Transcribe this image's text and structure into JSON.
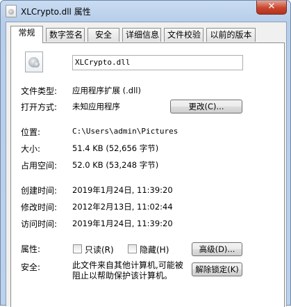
{
  "window": {
    "title": "XLCrypto.dll 属性",
    "close_label": "✕"
  },
  "tabs": [
    {
      "label": "常规",
      "active": true
    },
    {
      "label": "数字签名",
      "active": false
    },
    {
      "label": "安全",
      "active": false
    },
    {
      "label": "详细信息",
      "active": false
    },
    {
      "label": "文件校验",
      "active": false
    },
    {
      "label": "以前的版本",
      "active": false
    }
  ],
  "general": {
    "file_icon": "dll-gear-icon",
    "file_name": "XLCrypto.dll",
    "file_type_label": "文件类型:",
    "file_type_value": "应用程序扩展 (.dll)",
    "opens_with_label": "打开方式:",
    "opens_with_value": "未知应用程序",
    "change_button": "更改(C)...",
    "location_label": "位置:",
    "location_value": "C:\\Users\\admin\\Pictures",
    "size_label": "大小:",
    "size_value": "51.4 KB (52,656 字节)",
    "size_on_disk_label": "占用空间:",
    "size_on_disk_value": "52.0 KB (53,248 字节)",
    "created_label": "创建时间:",
    "created_value": "2019年1月24日, 11:39:20",
    "modified_label": "修改时间:",
    "modified_value": "2012年2月13日, 11:02:44",
    "accessed_label": "访问时间:",
    "accessed_value": "2019年1月24日, 11:39:20",
    "attributes_label": "属性:",
    "readonly_label": "只读(R)",
    "readonly_checked": false,
    "hidden_label": "隐藏(H)",
    "hidden_checked": false,
    "advanced_button": "高级(D)...",
    "security_label": "安全:",
    "security_text": "此文件来自其他计算机,可能被阻止以帮助保护该计算机。",
    "unblock_button": "解除锁定(K)"
  }
}
